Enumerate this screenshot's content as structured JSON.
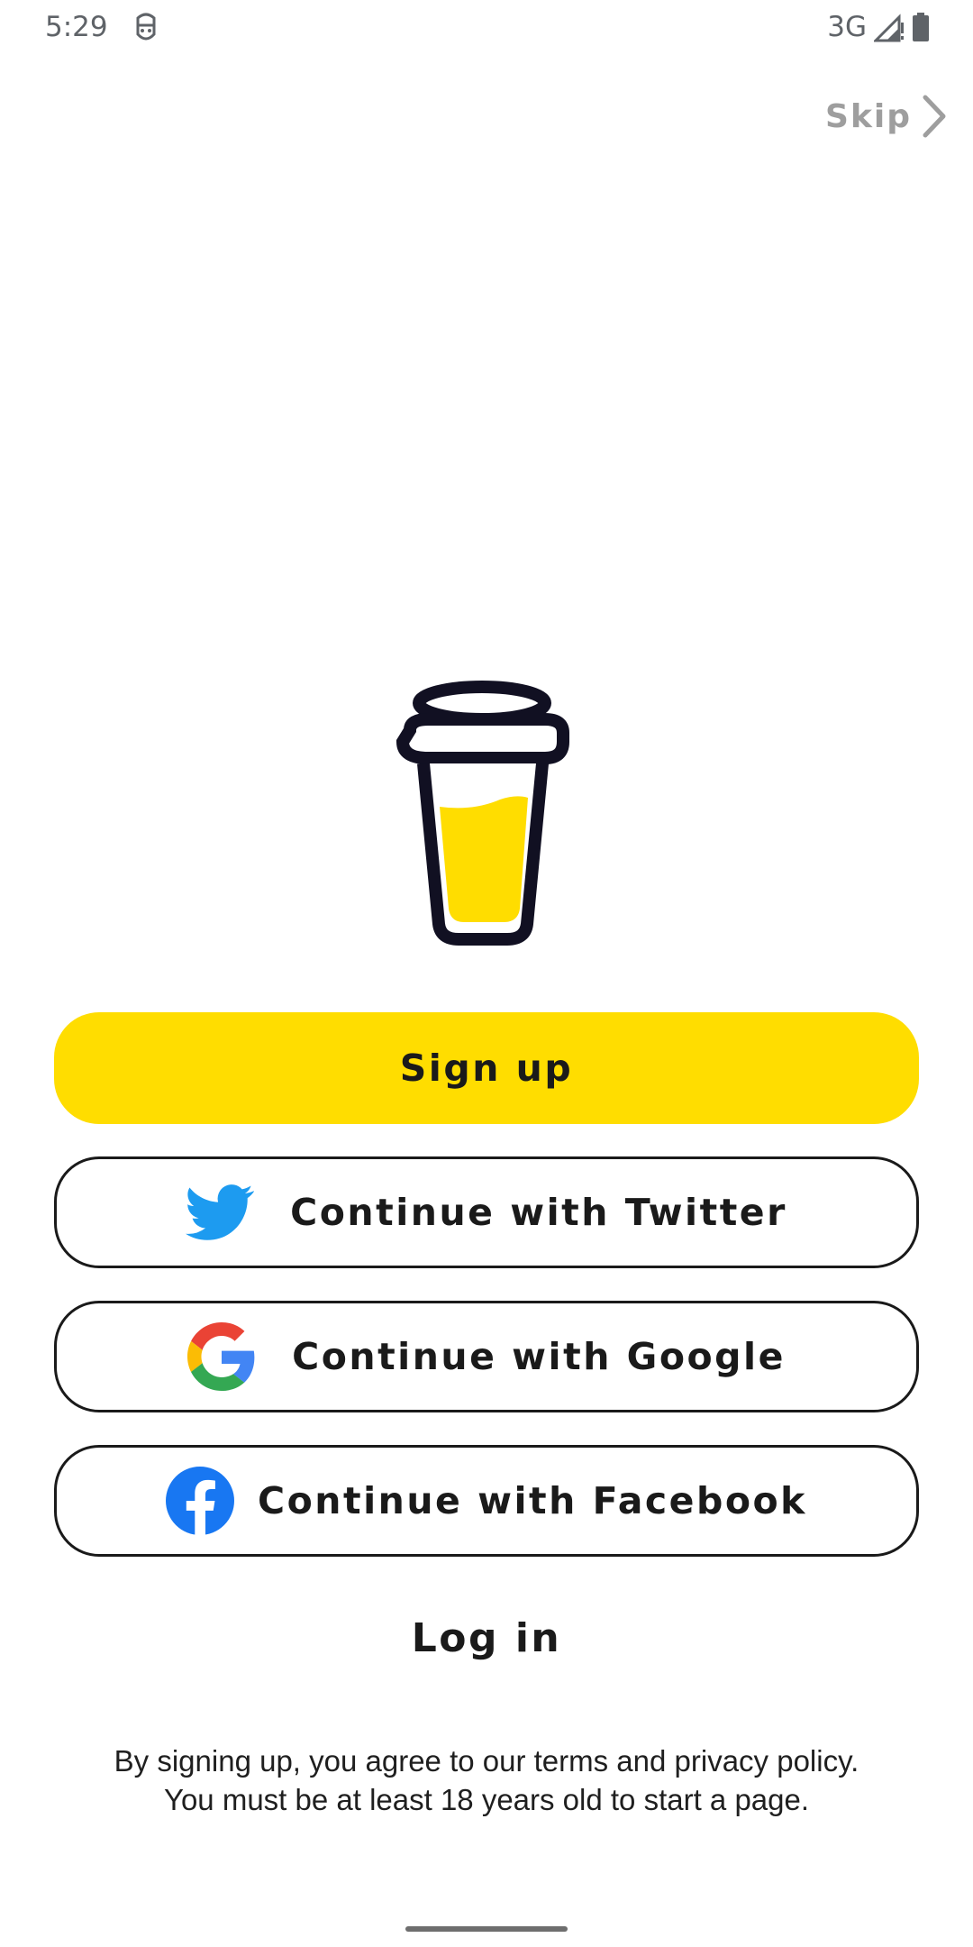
{
  "status_bar": {
    "time": "5:29",
    "network": "3G"
  },
  "skip": {
    "label": "Skip"
  },
  "buttons": {
    "signup": "Sign up",
    "twitter": "Continue with Twitter",
    "google": "Continue with Google",
    "facebook": "Continue with Facebook"
  },
  "login": {
    "label": "Log in"
  },
  "disclaimer": {
    "line1": "By signing up, you agree to our terms and privacy policy.",
    "line2": "You must be at least 18 years old to start a page."
  },
  "colors": {
    "accent": "#ffdd00",
    "twitter": "#1d9bf0",
    "facebook": "#1877f2",
    "skip": "#9e9e9e"
  },
  "icons": {
    "status_app": "android-face-icon",
    "status_signal": "signal-icon",
    "status_battery": "battery-icon",
    "skip": "chevron-right-icon",
    "logo": "coffee-cup-icon",
    "twitter": "twitter-icon",
    "google": "google-icon",
    "facebook": "facebook-icon"
  }
}
